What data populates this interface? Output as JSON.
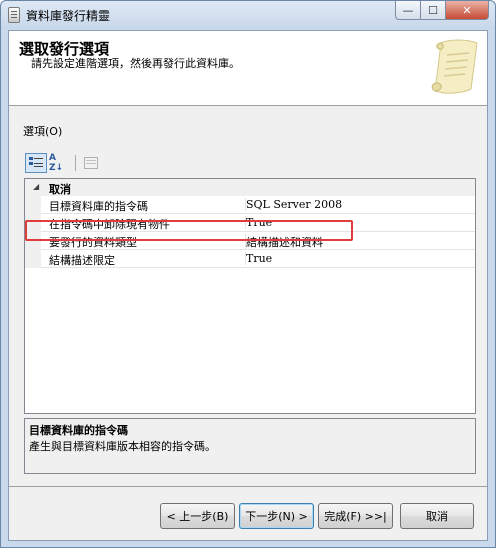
{
  "window": {
    "title": "資料庫發行精靈",
    "controls": {
      "minimize": "—",
      "maximize": "☐",
      "close": "✕"
    }
  },
  "header": {
    "title": "選取發行選項",
    "subtitle": "請先設定進階選項，然後再發行此資料庫。",
    "icon": "scroll-icon"
  },
  "options_label": "選項(O)",
  "toolbar": {
    "categorized_icon": "categorized-icon",
    "alphabetical_label": "A Z↓",
    "property_pages_icon": "property-pages-icon"
  },
  "grid": {
    "category": {
      "toggle": "◢",
      "label": "取消"
    },
    "rows": [
      {
        "name": "目標資料庫的指令碼",
        "value": "SQL Server 2008"
      },
      {
        "name": "在指令碼中卸除現有物件",
        "value": "True"
      },
      {
        "name": "要發行的資料類型",
        "value": "結構描述和資料"
      },
      {
        "name": "結構描述限定",
        "value": "True"
      }
    ],
    "highlight_color": "#e03c3c"
  },
  "description": {
    "title": "目標資料庫的指令碼",
    "text": "產生與目標資料庫版本相容的指令碼。"
  },
  "buttons": {
    "back": "< 上一步(B)",
    "next": "下一步(N) >",
    "finish": "完成(F) >>|",
    "cancel": "取消"
  }
}
